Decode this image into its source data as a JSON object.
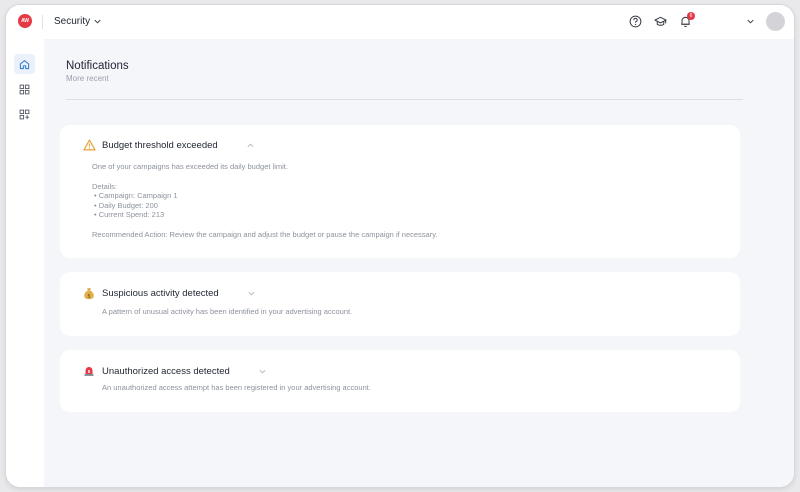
{
  "app": {
    "logo_text": "AW"
  },
  "header": {
    "workspace": "Security",
    "notifications_count": "6"
  },
  "page": {
    "title": "Notifications",
    "subtitle": "More recent"
  },
  "notifications": [
    {
      "icon": "warning-triangle-icon",
      "title": "Budget threshold exceeded",
      "expanded": true,
      "description": "One of your campaigns has exceeded its daily budget limit.",
      "details_label": "Details:",
      "details": [
        "Campaign: Campaign 1",
        "Daily Budget: 200",
        "Current Spend: 213"
      ],
      "recommended": "Recommended Action: Review the campaign and adjust the budget or pause the campaign if necessary."
    },
    {
      "icon": "money-bag-icon",
      "title": "Suspicious activity detected",
      "expanded": false,
      "description": "A pattern of unusual activity has been identified in your advertising account."
    },
    {
      "icon": "siren-icon",
      "title": "Unauthorized access detected",
      "expanded": false,
      "description": "An unauthorized access attempt has been registered in your advertising account."
    }
  ],
  "colors": {
    "accent": "#e63946",
    "warning": "#e8a13a",
    "active_nav": "#2f74d0"
  }
}
